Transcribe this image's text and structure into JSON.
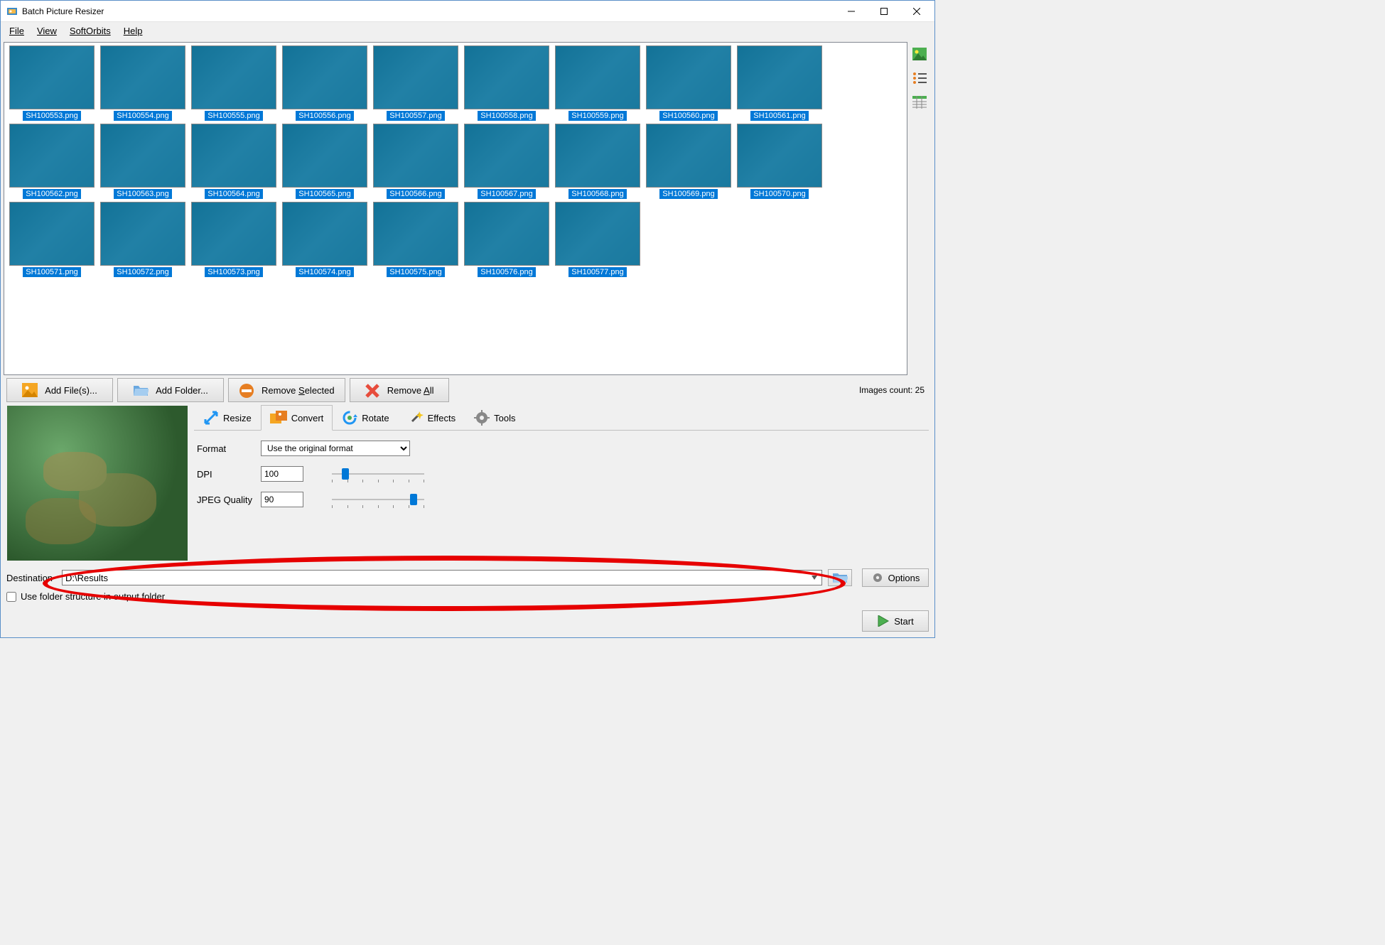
{
  "window": {
    "title": "Batch Picture Resizer"
  },
  "menu": {
    "file": "File",
    "view": "View",
    "softorbits": "SoftOrbits",
    "help": "Help"
  },
  "thumbs": [
    {
      "name": "SH100553.png"
    },
    {
      "name": "SH100554.png"
    },
    {
      "name": "SH100555.png"
    },
    {
      "name": "SH100556.png"
    },
    {
      "name": "SH100557.png"
    },
    {
      "name": "SH100558.png"
    },
    {
      "name": "SH100559.png"
    },
    {
      "name": "SH100560.png"
    },
    {
      "name": "SH100561.png"
    },
    {
      "name": "SH100562.png"
    },
    {
      "name": "SH100563.png"
    },
    {
      "name": "SH100564.png"
    },
    {
      "name": "SH100565.png"
    },
    {
      "name": "SH100566.png"
    },
    {
      "name": "SH100567.png"
    },
    {
      "name": "SH100568.png"
    },
    {
      "name": "SH100569.png"
    },
    {
      "name": "SH100570.png"
    },
    {
      "name": "SH100571.png"
    },
    {
      "name": "SH100572.png"
    },
    {
      "name": "SH100573.png"
    },
    {
      "name": "SH100574.png"
    },
    {
      "name": "SH100575.png"
    },
    {
      "name": "SH100576.png"
    },
    {
      "name": "SH100577.png"
    }
  ],
  "actions": {
    "add_files": "Add File(s)...",
    "add_folder": "Add Folder...",
    "remove_selected": "Remove Selected",
    "remove_all": "Remove All",
    "images_count_label": "Images count: 25"
  },
  "tabs": {
    "resize": "Resize",
    "convert": "Convert",
    "rotate": "Rotate",
    "effects": "Effects",
    "tools": "Tools"
  },
  "convert": {
    "format_label": "Format",
    "format_value": "Use the original format",
    "dpi_label": "DPI",
    "dpi_value": "100",
    "jpeg_label": "JPEG Quality",
    "jpeg_value": "90"
  },
  "dest": {
    "label": "Destination",
    "path": "D:\\Results",
    "folder_structure": "Use folder structure in output folder",
    "options": "Options",
    "start": "Start"
  }
}
